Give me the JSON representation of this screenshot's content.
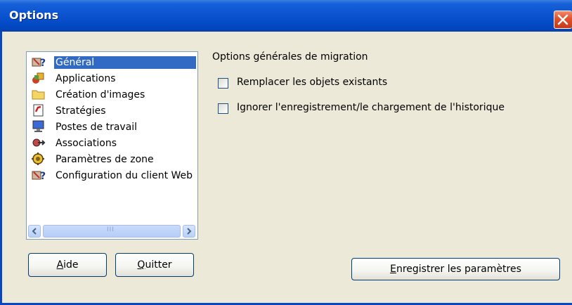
{
  "window": {
    "title": "Options",
    "close_icon": "close-x-icon"
  },
  "sidebar": {
    "items": [
      {
        "label": "Général",
        "icon": "general-icon",
        "selected": true
      },
      {
        "label": "Applications",
        "icon": "applications-icon",
        "selected": false
      },
      {
        "label": "Création d'images",
        "icon": "folder-icon",
        "selected": false
      },
      {
        "label": "Stratégies",
        "icon": "policy-icon",
        "selected": false
      },
      {
        "label": "Postes de travail",
        "icon": "computer-icon",
        "selected": false
      },
      {
        "label": "Associations",
        "icon": "associations-icon",
        "selected": false
      },
      {
        "label": "Paramètres de zone",
        "icon": "zone-settings-icon",
        "selected": false
      },
      {
        "label": "Configuration du client Web",
        "icon": "web-client-icon",
        "selected": false
      }
    ],
    "scrollbar": {
      "thumb_grip": "III"
    }
  },
  "main": {
    "section_title": "Options générales de migration",
    "checkboxes": [
      {
        "label": "Remplacer les objets existants",
        "checked": false
      },
      {
        "label": "Ignorer l'enregistrement/le chargement de l'historique",
        "checked": false
      }
    ]
  },
  "buttons": {
    "help": {
      "mnemonic": "A",
      "rest": "ide"
    },
    "quit": {
      "mnemonic": "Q",
      "rest": "uitter"
    },
    "save": {
      "mnemonic": "E",
      "rest": "nregistrer les paramètres"
    }
  },
  "colors": {
    "titlebar": "#0a52cf",
    "selection": "#316ac5",
    "window_bg": "#ece9d8",
    "close_button": "#e0502c"
  }
}
